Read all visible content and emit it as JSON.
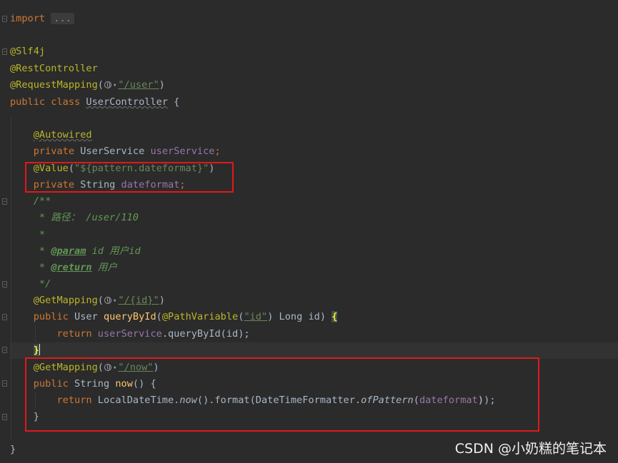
{
  "editor": {
    "language": "java",
    "lines": {
      "import_kw": "import",
      "import_folded": "...",
      "ann_slf4j": "@Slf4j",
      "ann_restcontroller": "@RestController",
      "ann_requestmapping": "@RequestMapping",
      "requestmapping_path": "\"/user\"",
      "class_decl_kw": "public class",
      "class_name": "UserController",
      "class_open": " {",
      "ann_autowired": "@Autowired",
      "private_kw": "private",
      "userservice_type": "UserService",
      "userservice_field": "userService",
      "ann_value": "@Value",
      "value_string": "\"${pattern.dateformat}\"",
      "string_type": "String",
      "dateformat_field": "dateformat",
      "doc_open": "/**",
      "doc_path": " * 路径： /user/110",
      "doc_star": " *",
      "doc_param_prefix": " * ",
      "doc_param_tag": "@param",
      "doc_param_text": " id 用户id",
      "doc_return_tag": "@return",
      "doc_return_text": " 用户",
      "doc_close": " */",
      "ann_getmapping": "@GetMapping",
      "getmapping_id_path": "\"/{id}\"",
      "public_kw": "public",
      "user_type": "User",
      "querybyid_name": "queryById",
      "ann_pathvariable": "@PathVariable",
      "pathvariable_value": "\"id\"",
      "long_param": " Long id) ",
      "return_kw": "return",
      "querybyid_call": ".queryById(id);",
      "close_brace": "}",
      "getmapping_now_path": "\"/now\"",
      "now_name": "now",
      "now_sig_rest": "() {",
      "localdatetime": "LocalDateTime.",
      "now_call": "now",
      "format_call": "().format(DateTimeFormatter.",
      "ofpattern": "ofPattern",
      "dateformat_arg": "dateformat",
      "closing_call": "));",
      "class_close": "}"
    }
  },
  "watermark": {
    "text": "CSDN @小奶糕的笔记本"
  },
  "colors": {
    "background": "#2b2b2b",
    "keyword": "#cc7832",
    "annotation": "#bbb529",
    "string": "#6a8759",
    "field": "#9876aa",
    "method": "#ffc66d",
    "comment": "#629755",
    "highlight_box": "#e0191b"
  },
  "icons": [
    "fold-marker-icon",
    "globe-icon",
    "chevron-down-icon"
  ]
}
